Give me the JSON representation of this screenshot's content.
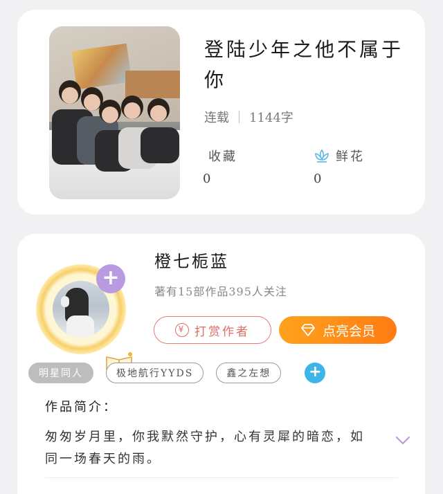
{
  "book": {
    "title": "登陆少年之他不属于你",
    "status": "连载",
    "word_count": "1144字",
    "favorites_label": "收藏",
    "favorites_count": "0",
    "flowers_label": "鲜花",
    "flowers_count": "0",
    "flower_icon_color": "#5bb8e0"
  },
  "author": {
    "name": "橙七栀蓝",
    "stats": "著有15部作品395人关注",
    "reward_label": "打赏作者",
    "reward_icon": "¥",
    "vip_label": "点亮会员",
    "follow_glyph": "+"
  },
  "tags": {
    "items": [
      "明星同人",
      "极地航行YYDS",
      "鑫之左想"
    ],
    "add_glyph": "+"
  },
  "intro": {
    "title": "作品简介：",
    "text": "匆匆岁月里，你我默然守护，心有灵犀的暗恋，如同一场春天的雨。"
  },
  "colors": {
    "reward": "#e06b66",
    "vip_start": "#ffa21c",
    "vip_end": "#ff7c14",
    "follow_badge": "#b89be0",
    "tag_add": "#3eb4e8",
    "expand_chevron": "#b89be0"
  },
  "icons": {
    "flower": "lotus-icon",
    "reward": "yen-icon",
    "vip": "diamond-icon",
    "expand": "chevron-down-icon"
  }
}
